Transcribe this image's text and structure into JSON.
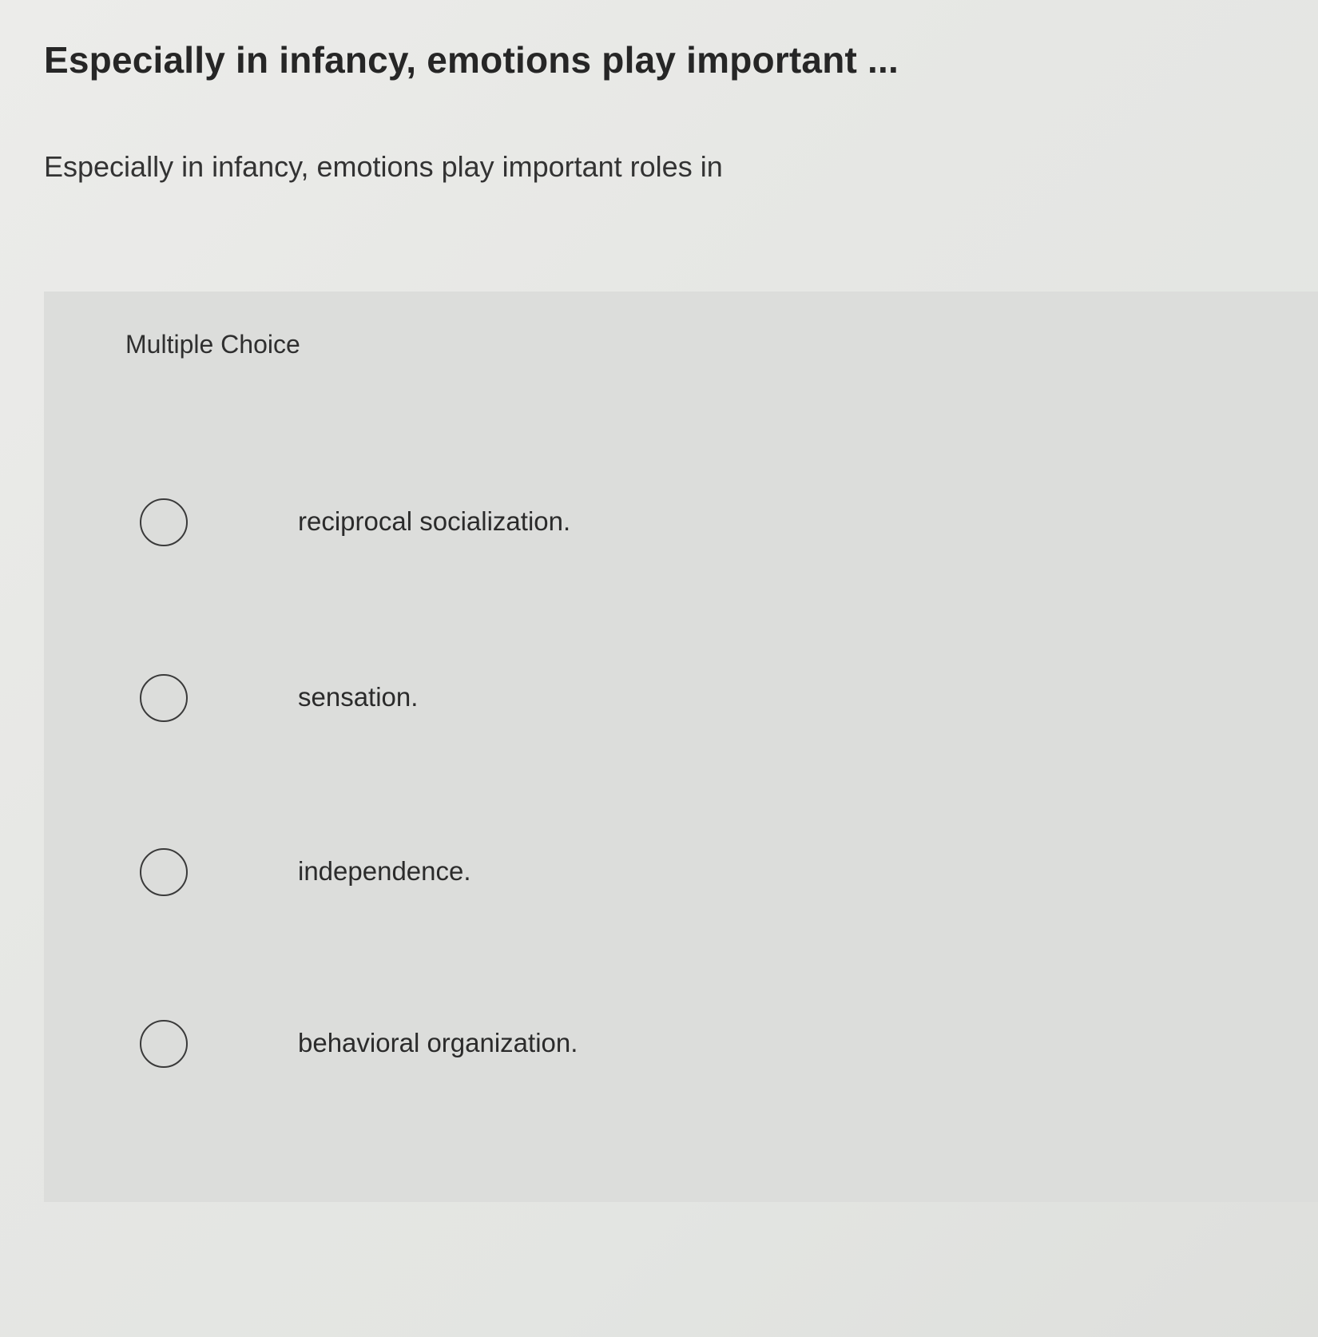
{
  "question": {
    "title": "Especially in infancy, emotions play important ...",
    "prompt": "Especially in infancy, emotions play important roles in",
    "type_label": "Multiple Choice",
    "options": [
      {
        "label": "reciprocal socialization.",
        "selected": false
      },
      {
        "label": "sensation.",
        "selected": false
      },
      {
        "label": "independence.",
        "selected": false
      },
      {
        "label": "behavioral organization.",
        "selected": false
      }
    ]
  }
}
